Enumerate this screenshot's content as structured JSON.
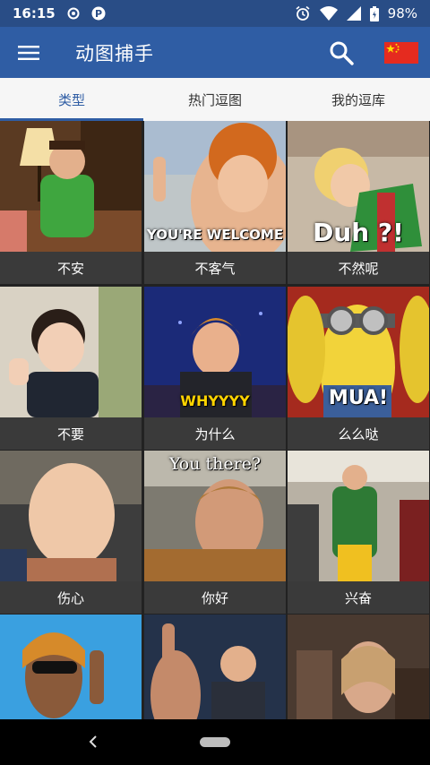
{
  "status_bar": {
    "time": "16:15",
    "battery": "98%",
    "left_icons": [
      "sync-icon",
      "p-notification-icon"
    ],
    "right_icons": [
      "alarm-icon",
      "wifi-icon",
      "signal-icon",
      "battery-icon"
    ]
  },
  "app_bar": {
    "title": "动图捕手",
    "menu_icon": "hamburger-menu-icon",
    "search_icon": "search-icon",
    "flag_icon": "china-flag-icon",
    "color": "#2f5da4"
  },
  "tabs": [
    {
      "label": "类型",
      "active": true
    },
    {
      "label": "热门逗图",
      "active": false
    },
    {
      "label": "我的逗库",
      "active": false
    }
  ],
  "grid": [
    {
      "caption": "不安",
      "meme_text": ""
    },
    {
      "caption": "不客气",
      "meme_text": "YOU'RE WELCOME"
    },
    {
      "caption": "不然呢",
      "meme_text": "Duh ?!"
    },
    {
      "caption": "不要",
      "meme_text": ""
    },
    {
      "caption": "为什么",
      "meme_text": "WHYYYY"
    },
    {
      "caption": "么么哒",
      "meme_text": "MUA!"
    },
    {
      "caption": "伤心",
      "meme_text": ""
    },
    {
      "caption": "你好",
      "meme_text": "You there?"
    },
    {
      "caption": "兴奋",
      "meme_text": ""
    },
    {
      "caption": "",
      "meme_text": ""
    },
    {
      "caption": "",
      "meme_text": ""
    },
    {
      "caption": "",
      "meme_text": ""
    }
  ],
  "nav_bar": {
    "back_icon": "back-chevron-icon",
    "home_icon": "home-pill-icon"
  }
}
